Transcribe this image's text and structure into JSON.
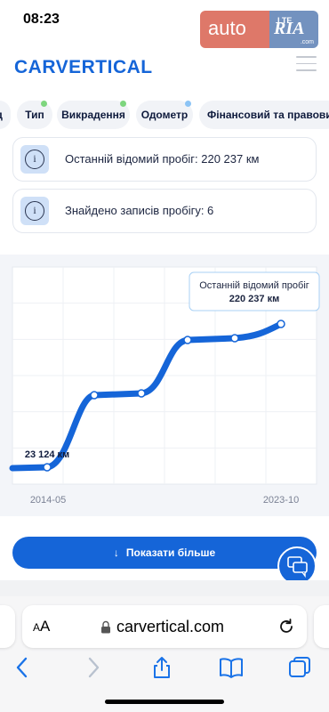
{
  "status_bar": {
    "time": "08:23",
    "network": "LTE",
    "watermark_left": "auto",
    "watermark_right": "RIA",
    "watermark_domain": ".com"
  },
  "header": {
    "logo": "CARVERTICAL"
  },
  "tabs": [
    {
      "label": "д",
      "dot": false
    },
    {
      "label": "Тип",
      "dot": true,
      "dot_color": "#7ed67e"
    },
    {
      "label": "Викрадення",
      "dot": true,
      "dot_color": "#7ed67e"
    },
    {
      "label": "Одометр",
      "dot": true,
      "dot_color": "#8cc4f5",
      "active": true
    },
    {
      "label": "Фінансовий та правовий",
      "dot": false
    }
  ],
  "info_cards": [
    {
      "icon": "info-icon",
      "text": "Останній відомий пробіг: 220 237 км"
    },
    {
      "icon": "info-icon",
      "text": "Знайдено записів пробігу: 6"
    }
  ],
  "chart_data": {
    "type": "line",
    "x_tick_labels": [
      "2014-05",
      "2023-10"
    ],
    "points": [
      {
        "order": 1,
        "value_label": "23 124 км"
      },
      {
        "order": 2
      },
      {
        "order": 3
      },
      {
        "order": 4
      },
      {
        "order": 5
      },
      {
        "order": 6
      }
    ],
    "tooltip_title": "Останній відомий пробіг",
    "tooltip_value": "220 237 км",
    "first_value_label": "23 124 км",
    "line_color": "#1565d8"
  },
  "actions": {
    "show_more": "Показати більше",
    "show_more_icon": "arrow-down-icon",
    "chat_icon": "chat-icon"
  },
  "browser": {
    "text_size_label": "AA",
    "url": "carvertical.com",
    "toolbar": [
      "back-icon",
      "forward-icon",
      "share-icon",
      "bookmarks-icon",
      "tabs-icon"
    ]
  }
}
